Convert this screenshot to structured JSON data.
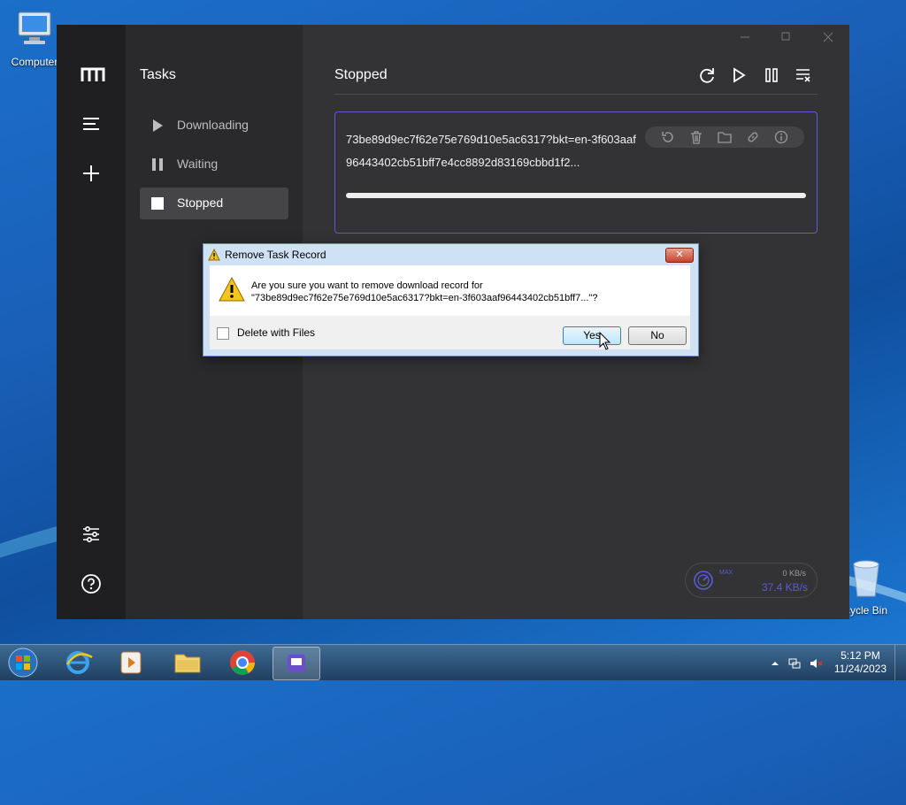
{
  "desktop": {
    "icons": [
      {
        "label": "Computer",
        "icon": "computer-icon"
      },
      {
        "label": "cycle Bin",
        "icon": "recycle-bin-icon"
      }
    ]
  },
  "app": {
    "sidebar": {
      "title": "Tasks",
      "items": [
        {
          "label": "Downloading",
          "icon": "play-icon",
          "active": false
        },
        {
          "label": "Waiting",
          "icon": "pause-icon",
          "active": false
        },
        {
          "label": "Stopped",
          "icon": "stop-icon",
          "active": true
        }
      ]
    },
    "main": {
      "title": "Stopped",
      "toolbar": [
        "refresh-icon",
        "resume-all-icon",
        "pause-all-icon",
        "clear-list-icon"
      ],
      "task": {
        "name": "73be89d9ec7f62e75e769d10e5ac6317?bkt=en-3f603aaf96443402cb51bff7e4cc8892d83169cbbd1f2...",
        "actions": [
          "restart-icon",
          "delete-icon",
          "folder-icon",
          "link-icon",
          "info-icon"
        ],
        "progress": 1.0
      }
    },
    "speedometer": {
      "max_label": "MAX",
      "upload": "0 KB/s",
      "download": "37.4 KB/s"
    },
    "accent_color": "#5b5bd6"
  },
  "dialog": {
    "title": "Remove Task Record",
    "message_line1": "Are you sure you want to remove download record for",
    "message_line2": "\"73be89d9ec7f62e75e769d10e5ac6317?bkt=en-3f603aaf96443402cb51bff7...\"?",
    "checkbox_label": "Delete with Files",
    "checkbox_checked": false,
    "yes_label": "Yes",
    "no_label": "No",
    "close_label": "✕"
  },
  "taskbar": {
    "time": "5:12 PM",
    "date": "11/24/2023",
    "apps": [
      "internet-explorer-icon",
      "media-player-icon",
      "file-explorer-icon",
      "chrome-icon",
      "motrix-icon"
    ]
  }
}
